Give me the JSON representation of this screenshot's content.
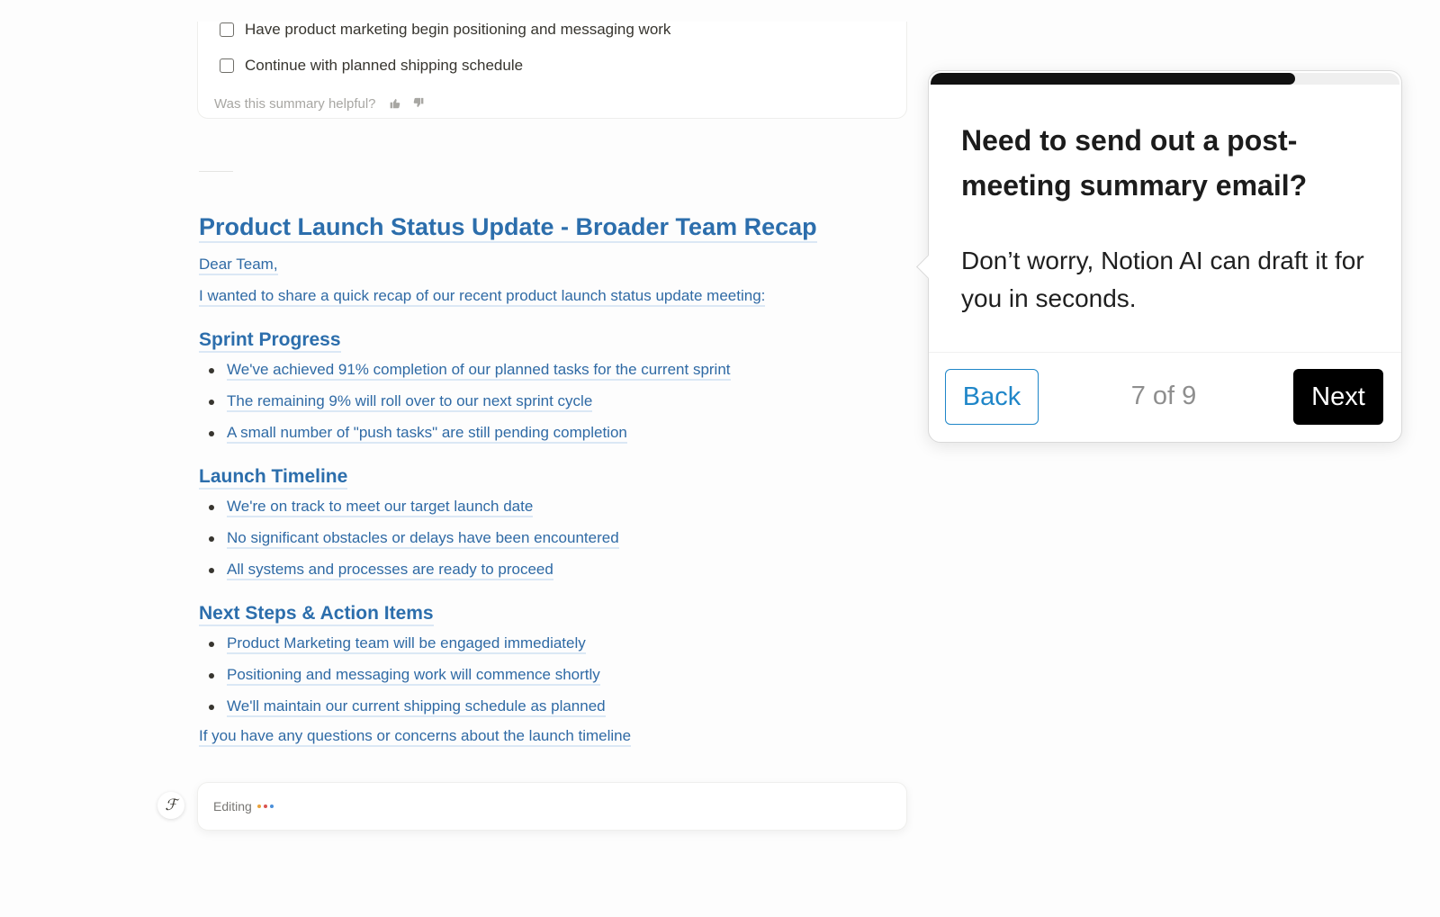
{
  "summary_card": {
    "cut_item": "Have product marketing begin positioning and messaging work",
    "item": "Continue with planned shipping schedule",
    "feedback_prompt": "Was this summary helpful?",
    "thumbs_up_icon": "thumbs-up-icon",
    "thumbs_down_icon": "thumbs-down-icon"
  },
  "document": {
    "title": "Product Launch Status Update - Broader Team Recap",
    "greeting": "Dear Team,",
    "intro": "I wanted to share a quick recap of our recent product launch status update meeting:",
    "sections": [
      {
        "heading": "Sprint Progress",
        "items": [
          "We've achieved 91% completion of our planned tasks for the current sprint",
          "The remaining 9% will roll over to our next sprint cycle",
          "A small number of \"push tasks\" are still pending completion"
        ]
      },
      {
        "heading": "Launch Timeline",
        "items": [
          "We're on track to meet our target launch date",
          "No significant obstacles or delays have been encountered",
          "All systems and processes are ready to proceed"
        ]
      },
      {
        "heading": "Next Steps & Action Items",
        "items": [
          "Product Marketing team will be engaged immediately",
          "Positioning and messaging work will commence shortly",
          "We'll maintain our current shipping schedule as planned"
        ]
      }
    ],
    "closing": "If you have any questions or concerns about the launch timeline"
  },
  "editing_bar": {
    "label": "Editing",
    "dot_colors": [
      "#e8a23a",
      "#d9534f",
      "#4a8fd9"
    ],
    "avatar_icon": "notion-ai-face-icon"
  },
  "tour": {
    "progress_fraction": 0.778,
    "title": "Need to send out a post-meeting summary email?",
    "body": "Don’t worry, Notion AI can draft it for you in seconds.",
    "back_label": "Back",
    "step_text": "7 of 9",
    "next_label": "Next"
  }
}
